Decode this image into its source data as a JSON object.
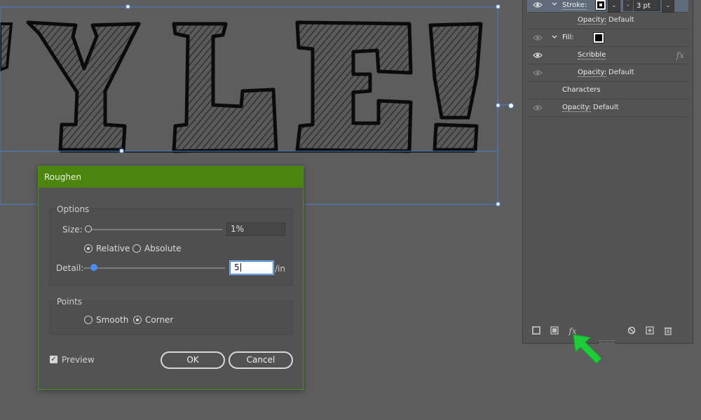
{
  "canvas": {
    "artwork_text": "YLE!"
  },
  "appearance_panel": {
    "stroke": {
      "label": "Stroke:",
      "weight": "3 pt"
    },
    "stroke_opacity": {
      "label": "Opacity:",
      "value": "Default"
    },
    "fill": {
      "label": "Fill:"
    },
    "scribble": {
      "label": "Scribble"
    },
    "fill_opacity": {
      "label": "Opacity:",
      "value": "Default"
    },
    "characters": {
      "label": "Characters"
    },
    "opacity": {
      "label": "Opacity:",
      "value": "Default"
    },
    "toolbar": {
      "add_stroke_icon": "square-outline-icon",
      "add_fill_icon": "square-fill-icon",
      "fx_label": "fx",
      "clear_icon": "no-sign-icon",
      "duplicate_icon": "plus-square-icon",
      "delete_icon": "trash-icon"
    },
    "accent_arrow_color": "#1ecb3a"
  },
  "roughen_dialog": {
    "title": "Roughen",
    "title_bar_color": "#4c850e",
    "options_group": {
      "title": "Options",
      "size_label": "Size:",
      "size_value": "1%",
      "size_slider_fraction": 0.01,
      "relative_label": "Relative",
      "absolute_label": "Absolute",
      "selected_mode": "Relative",
      "detail_label": "Detail:",
      "detail_value": "5",
      "detail_unit": "/in",
      "detail_slider_fraction": 0.05
    },
    "points_group": {
      "title": "Points",
      "smooth_label": "Smooth",
      "corner_label": "Corner",
      "selected_point": "Corner"
    },
    "preview_label": "Preview",
    "preview_checked": true,
    "ok_label": "OK",
    "cancel_label": "Cancel"
  }
}
